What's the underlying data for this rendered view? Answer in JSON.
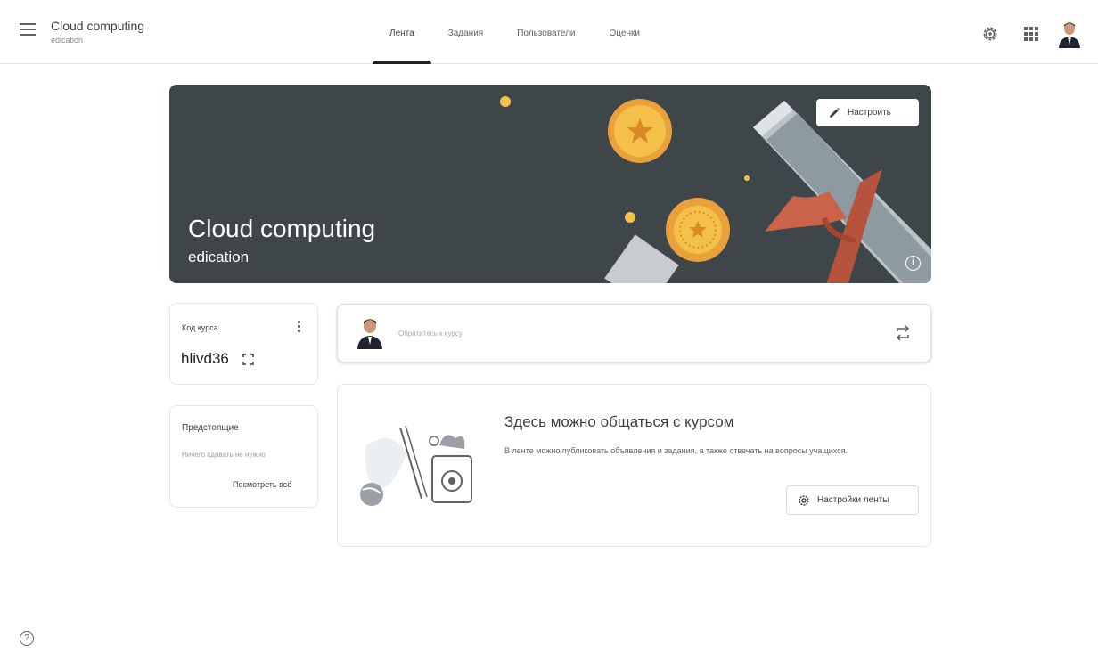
{
  "header": {
    "course_title": "Cloud computing",
    "course_subtitle": "edication",
    "tabs": [
      {
        "label": "Лента",
        "active": true
      },
      {
        "label": "Задания",
        "active": false
      },
      {
        "label": "Пользователи",
        "active": false
      },
      {
        "label": "Оценки",
        "active": false
      }
    ],
    "icons": [
      "menu-icon",
      "settings-gear-icon",
      "apps-grid-icon",
      "user-avatar"
    ]
  },
  "banner": {
    "title": "Cloud computing",
    "subtitle": "edication",
    "customize_label": "Настроить",
    "background_color": "#3e4649"
  },
  "class_code": {
    "label": "Код курса",
    "value": "hlivd36"
  },
  "upcoming": {
    "title": "Предстоящие",
    "empty_text": "Ничего сдавать не нужно",
    "view_all_label": "Посмотреть всё"
  },
  "post_box": {
    "placeholder": "Обратитесь к курсу"
  },
  "feed_empty": {
    "heading": "Здесь можно общаться с курсом",
    "description": "В ленте можно публиковать объявления и задания, а также отвечать на вопросы учащихся.",
    "settings_label": "Настройки ленты"
  }
}
